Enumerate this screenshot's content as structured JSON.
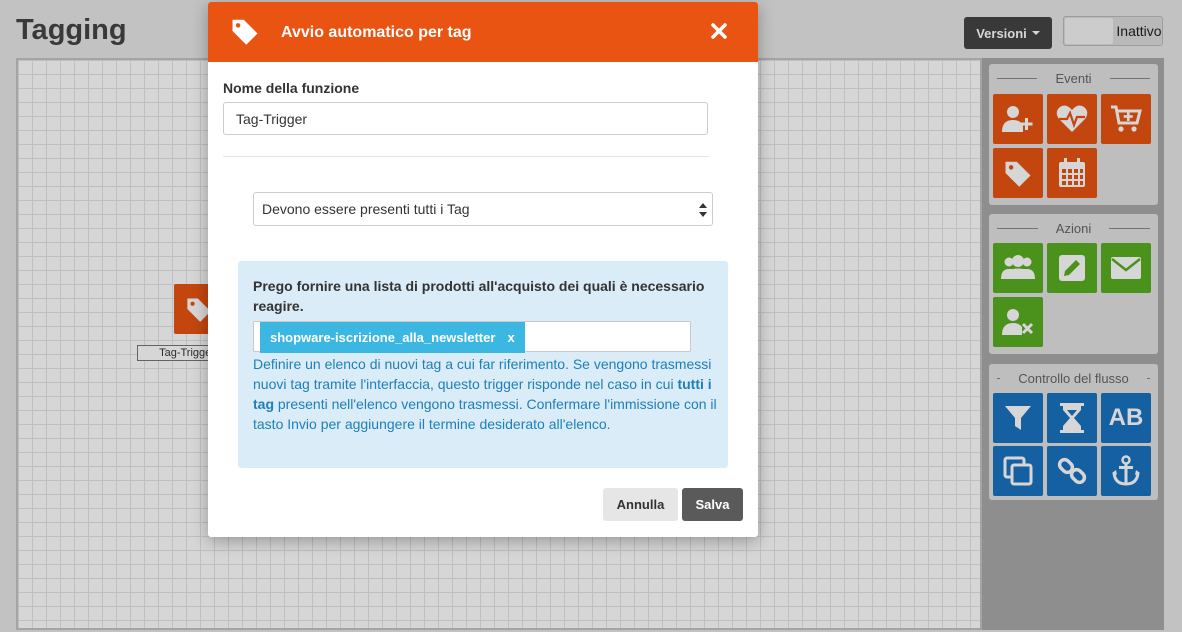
{
  "page": {
    "title": "Tagging",
    "versions_label": "Versioni",
    "status_label": "Inattivo"
  },
  "canvas": {
    "node_label": "Tag-Trigger",
    "node_icon": "tag-icon"
  },
  "sidebar": {
    "events": {
      "title": "Eventi",
      "items": [
        {
          "icon": "add-user-icon"
        },
        {
          "icon": "heartbeat-icon"
        },
        {
          "icon": "cart-add-icon"
        },
        {
          "icon": "tag-icon"
        },
        {
          "icon": "calendar-icon"
        }
      ]
    },
    "actions": {
      "title": "Azioni",
      "items": [
        {
          "icon": "users-icon"
        },
        {
          "icon": "edit-icon"
        },
        {
          "icon": "envelope-icon"
        },
        {
          "icon": "remove-user-icon"
        }
      ]
    },
    "flow": {
      "title": "Controllo del flusso",
      "items": [
        {
          "icon": "filter-icon"
        },
        {
          "icon": "hourglass-icon"
        },
        {
          "icon": "ab-test-icon",
          "text": "AB"
        },
        {
          "icon": "copy-icon"
        },
        {
          "icon": "link-icon"
        },
        {
          "icon": "anchor-icon"
        }
      ]
    }
  },
  "modal": {
    "title": "Avvio automatico per tag",
    "close_glyph": "✖",
    "name_label": "Nome della funzione",
    "name_value": "Tag-Trigger",
    "match_select_value": "Devono essere presenti tutti i Tag",
    "info_heading": "Prego fornire una lista di prodotti all'acquisto dei quali è necessario reagire.",
    "tag_chip": "shopware-iscrizione_alla_newsletter",
    "tag_chip_remove": "x",
    "help_part1": "Definire un elenco di nuovi tag a cui far riferimento. Se vengono trasmessi nuovi tag tramite l'interfaccia, questo trigger risponde nel caso in cui ",
    "help_bold": "tutti i tag",
    "help_part2": " presenti nell'elenco vengono trasmessi. Confermare l'immissione con il tasto Invio per aggiungere il termine desiderato all'elenco.",
    "cancel_label": "Annulla",
    "save_label": "Salva"
  },
  "colors": {
    "orange": "#e95413",
    "green": "#5aae22",
    "blue": "#1a73c0",
    "info_bg": "#d9ecf8",
    "chip": "#3bb7e2"
  }
}
